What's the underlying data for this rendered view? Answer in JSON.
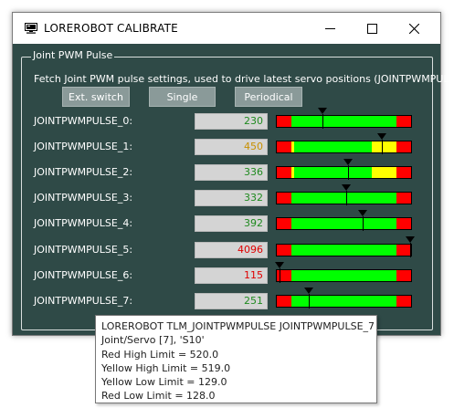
{
  "window": {
    "title": "LOREROBOT CALIBRATE",
    "app_icon": "monitor-icon",
    "controls": [
      "minimize-icon",
      "maximize-icon",
      "close-icon"
    ]
  },
  "group": {
    "title": "Joint PWM Pulse",
    "description": "Fetch Joint PWM pulse settings, used to drive latest servo positions (JOINTPWMPULSE)"
  },
  "buttons": {
    "ext_switch": "Ext. switch",
    "single": "Single",
    "periodical": "Periodical"
  },
  "colors": {
    "background": "#2f4a47",
    "red": "#ff0000",
    "yellow": "#ffff00",
    "green": "#00ff00",
    "value_green": "#008000",
    "value_yellow": "#b58b00",
    "value_red": "#e00000"
  },
  "rows": [
    {
      "label": "JOINTPWMPULSE_0:",
      "value": "230",
      "value_color": "#1f8a1f",
      "limits": {
        "red_low": 128,
        "yellow_low": 129,
        "yellow_high": 519,
        "red_high": 520
      },
      "marker_fraction": 0.34
    },
    {
      "label": "JOINTPWMPULSE_1:",
      "value": "450",
      "value_color": "#c89000",
      "limits": {
        "red_low": 128,
        "yellow_low": 140,
        "yellow_high": 430,
        "red_high": 520
      },
      "marker_fraction": 0.78
    },
    {
      "label": "JOINTPWMPULSE_2:",
      "value": "336",
      "value_color": "#1f8a1f",
      "limits": {
        "red_low": 128,
        "yellow_low": 140,
        "yellow_high": 430,
        "red_high": 520
      },
      "marker_fraction": 0.53
    },
    {
      "label": "JOINTPWMPULSE_3:",
      "value": "332",
      "value_color": "#1f8a1f",
      "limits": {
        "red_low": 128,
        "yellow_low": 129,
        "yellow_high": 519,
        "red_high": 520
      },
      "marker_fraction": 0.52
    },
    {
      "label": "JOINTPWMPULSE_4:",
      "value": "392",
      "value_color": "#1f8a1f",
      "limits": {
        "red_low": 128,
        "yellow_low": 129,
        "yellow_high": 519,
        "red_high": 520
      },
      "marker_fraction": 0.64
    },
    {
      "label": "JOINTPWMPULSE_5:",
      "value": "4096",
      "value_color": "#e00000",
      "limits": {
        "red_low": 128,
        "yellow_low": 129,
        "yellow_high": 519,
        "red_high": 520
      },
      "marker_fraction": 0.99
    },
    {
      "label": "JOINTPWMPULSE_6:",
      "value": "115",
      "value_color": "#e00000",
      "limits": {
        "red_low": 128,
        "yellow_low": 129,
        "yellow_high": 519,
        "red_high": 520
      },
      "marker_fraction": 0.02
    },
    {
      "label": "JOINTPWMPULSE_7:",
      "value": "251",
      "value_color": "#1f8a1f",
      "limits": {
        "red_low": 128,
        "yellow_low": 129,
        "yellow_high": 519,
        "red_high": 520
      },
      "marker_fraction": 0.24
    }
  ],
  "tooltip": {
    "line1": "LOREROBOT TLM_JOINTPWMPULSE JOINTPWMPULSE_7",
    "line2": "Joint/Servo [7], 'S10'",
    "line3": "Red High Limit = 520.0",
    "line4": "Yellow High Limit = 519.0",
    "line5": "Yellow Low Limit = 129.0",
    "line6": "Red Low Limit = 128.0"
  }
}
